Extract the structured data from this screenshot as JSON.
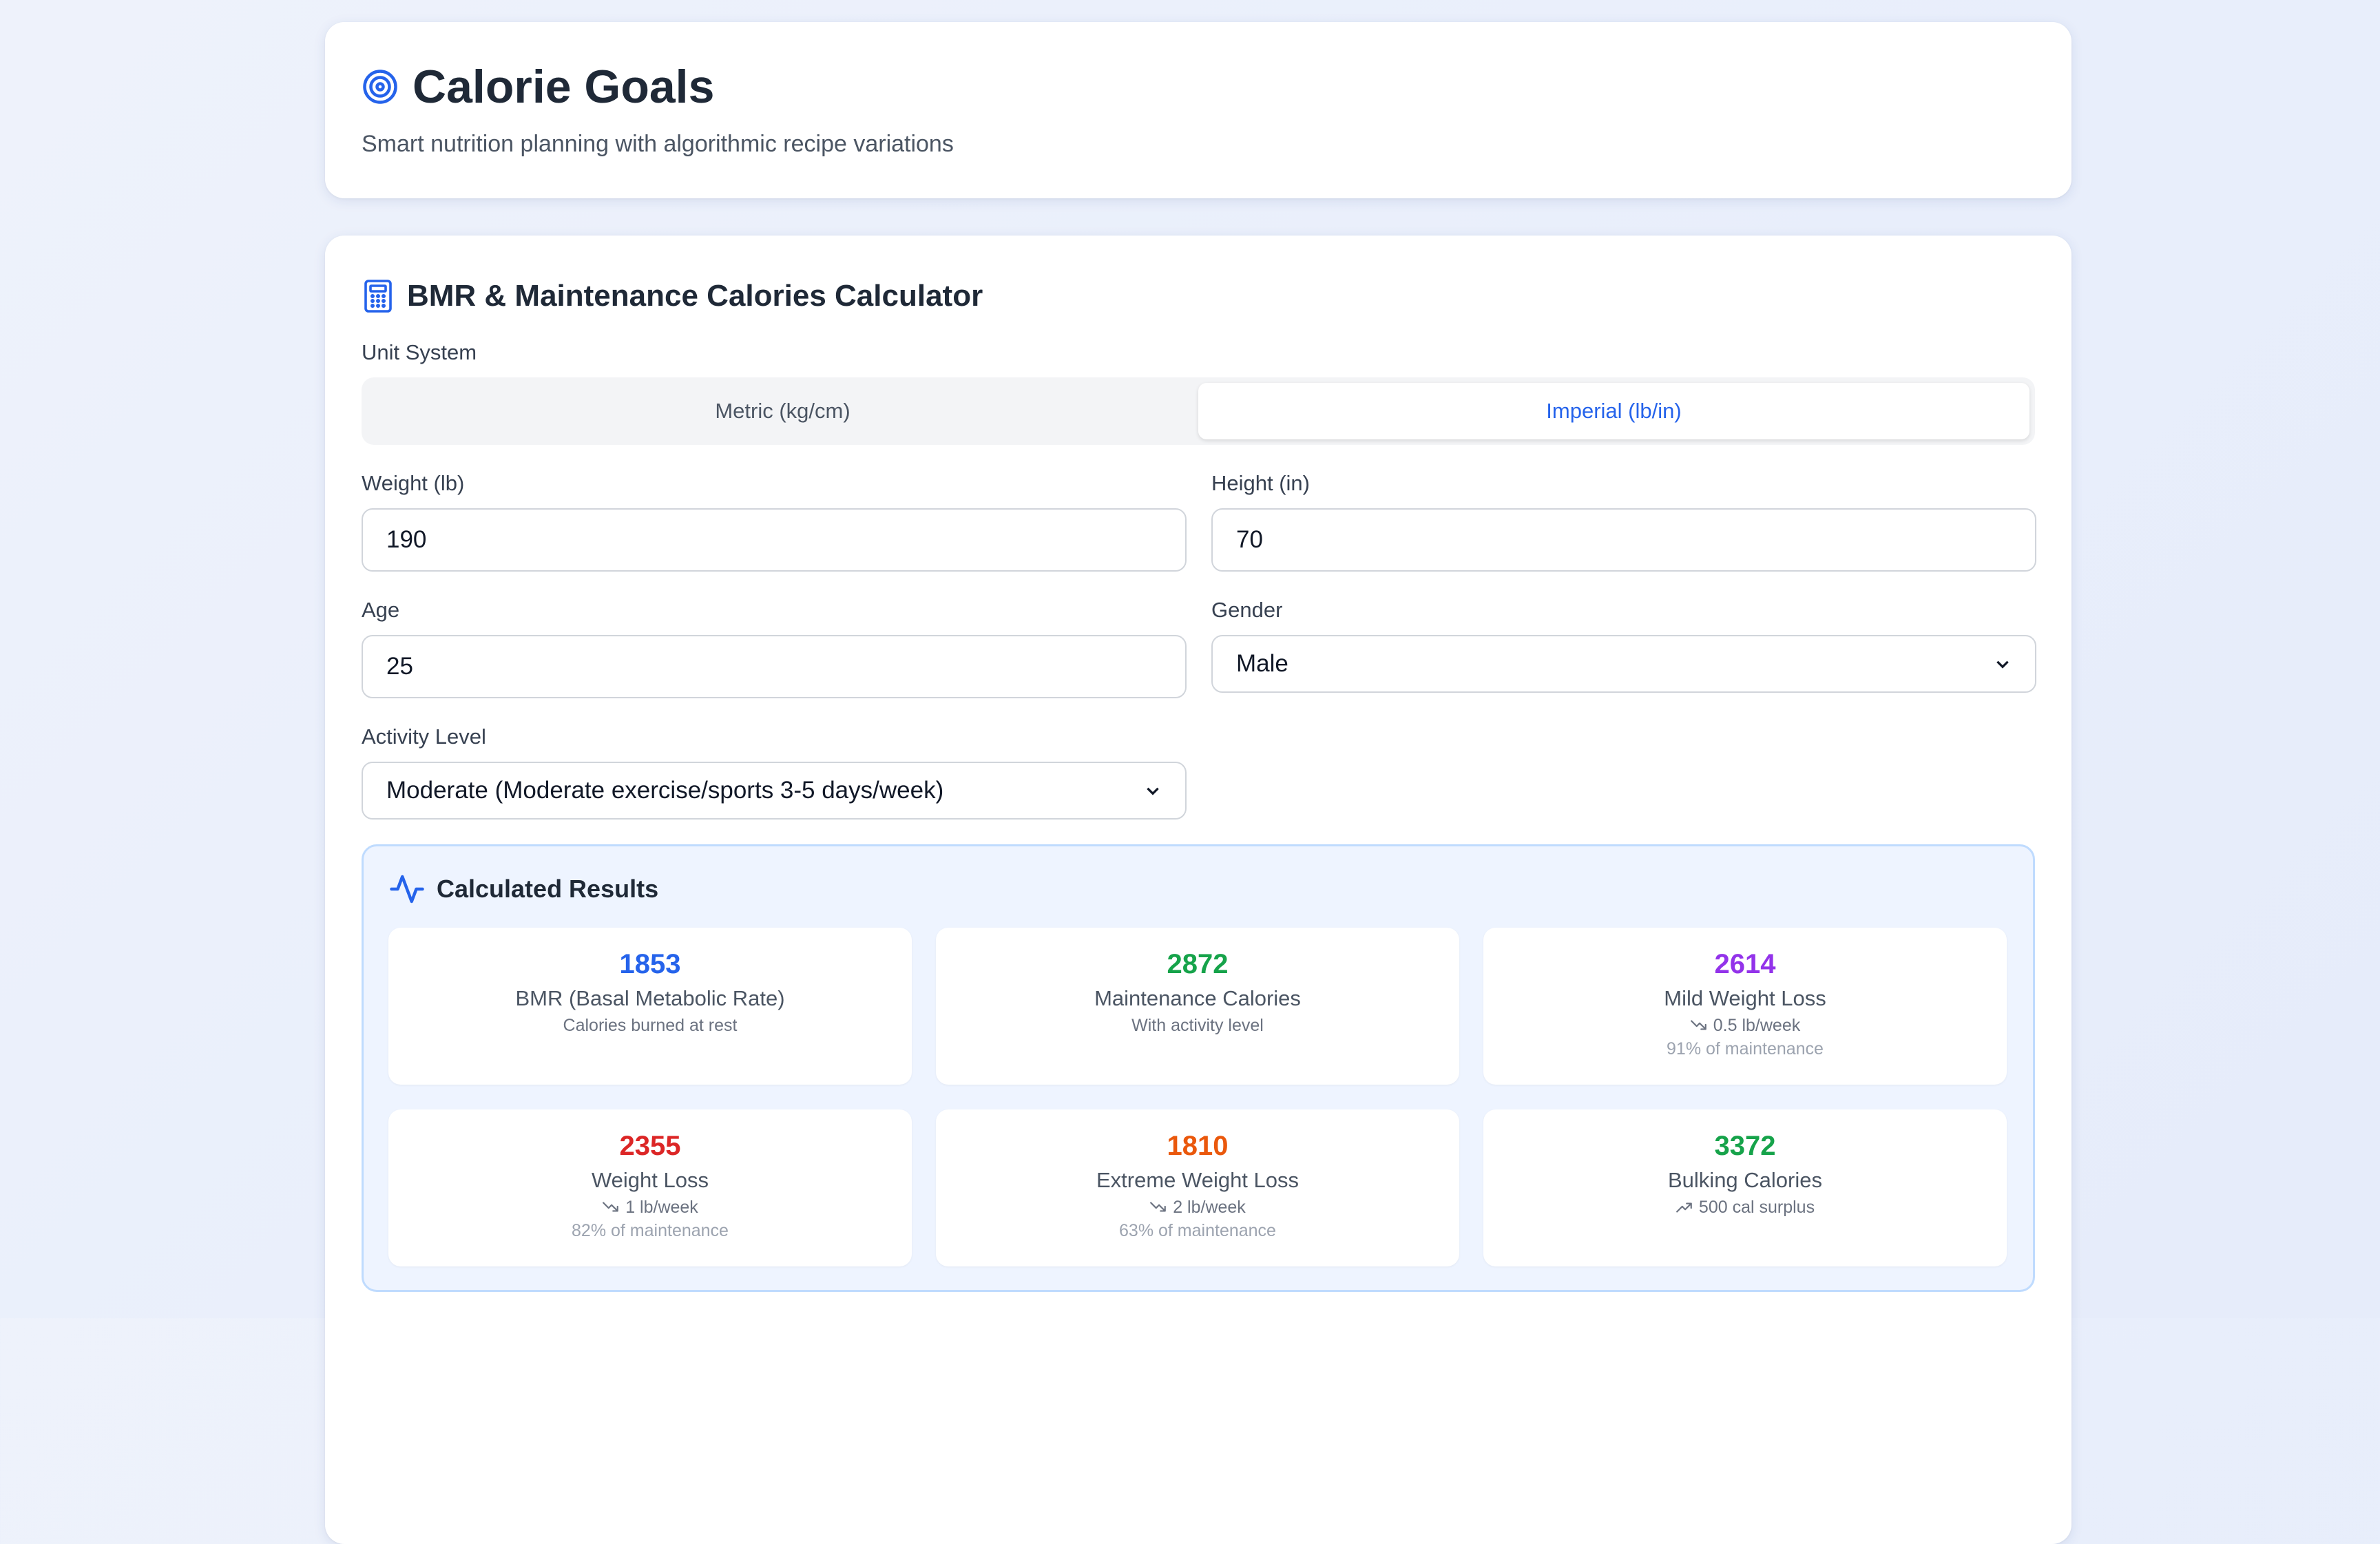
{
  "header": {
    "title": "Calorie Goals",
    "subtitle": "Smart nutrition planning with algorithmic recipe variations",
    "icon": "target-icon",
    "accent": "#2563eb"
  },
  "calculator": {
    "title": "BMR & Maintenance Calories Calculator",
    "icon": "calculator-icon",
    "unit_system": {
      "label": "Unit System",
      "options": [
        "Metric (kg/cm)",
        "Imperial (lb/in)"
      ],
      "selected": "Imperial (lb/in)"
    },
    "weight": {
      "label": "Weight (lb)",
      "value": "190"
    },
    "height": {
      "label": "Height (in)",
      "value": "70"
    },
    "age": {
      "label": "Age",
      "value": "25"
    },
    "gender": {
      "label": "Gender",
      "value": "Male"
    },
    "activity": {
      "label": "Activity Level",
      "value": "Moderate (Moderate exercise/sports 3-5 days/week)"
    }
  },
  "results": {
    "title": "Calculated Results",
    "icon": "activity-icon",
    "cards": [
      {
        "value": "1853",
        "label": "BMR (Basal Metabolic Rate)",
        "sub": "Calories burned at rest",
        "color": "#2563eb"
      },
      {
        "value": "2872",
        "label": "Maintenance Calories",
        "sub": "With activity level",
        "color": "#16a34a"
      },
      {
        "value": "2614",
        "label": "Mild Weight Loss",
        "sub": "0.5 lb/week",
        "pct": "91% of maintenance",
        "trend": "down",
        "color": "#9333ea"
      },
      {
        "value": "2355",
        "label": "Weight Loss",
        "sub": "1 lb/week",
        "pct": "82% of maintenance",
        "trend": "down",
        "color": "#dc2626"
      },
      {
        "value": "1810",
        "label": "Extreme Weight Loss",
        "sub": "2 lb/week",
        "pct": "63% of maintenance",
        "trend": "down",
        "color": "#ea580c"
      },
      {
        "value": "3372",
        "label": "Bulking Calories",
        "sub": "500 cal surplus",
        "trend": "up",
        "color": "#16a34a"
      }
    ]
  }
}
